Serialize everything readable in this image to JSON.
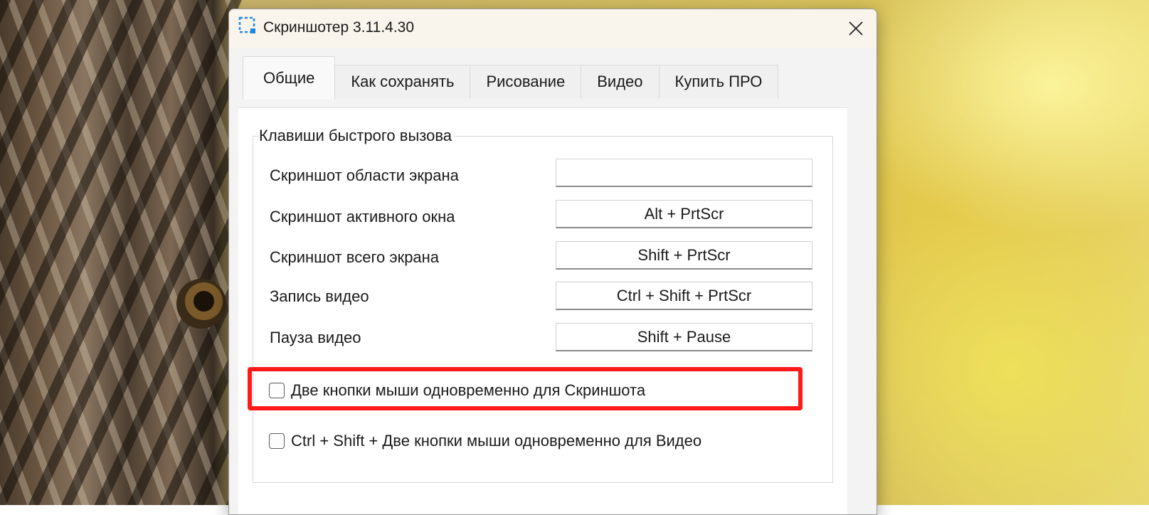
{
  "window": {
    "title": "Скриншотер 3.11.4.30"
  },
  "tabs": [
    {
      "label": "Общие",
      "active": true
    },
    {
      "label": "Как сохранять",
      "active": false
    },
    {
      "label": "Рисование",
      "active": false
    },
    {
      "label": "Видео",
      "active": false
    },
    {
      "label": "Купить ПРО",
      "active": false
    }
  ],
  "hotkeys": {
    "group_title": "Клавиши быстрого вызова",
    "rows": [
      {
        "label": "Скриншот области экрана",
        "value": ""
      },
      {
        "label": "Скриншот активного окна",
        "value": "Alt + PrtScr"
      },
      {
        "label": "Скриншот всего экрана",
        "value": "Shift + PrtScr"
      },
      {
        "label": "Запись видео",
        "value": "Ctrl + Shift + PrtScr"
      },
      {
        "label": "Пауза видео",
        "value": "Shift + Pause"
      }
    ]
  },
  "options": [
    {
      "label": "Две кнопки мыши одновременно для Скриншота",
      "checked": false
    },
    {
      "label": "Ctrl + Shift + Две кнопки мыши одновременно для Видео",
      "checked": false
    }
  ],
  "colors": {
    "highlight": "#ff1a1a",
    "app_icon": "#1e88e5"
  },
  "icons": {
    "app": "screenshot-selection-icon",
    "close": "close-icon"
  }
}
